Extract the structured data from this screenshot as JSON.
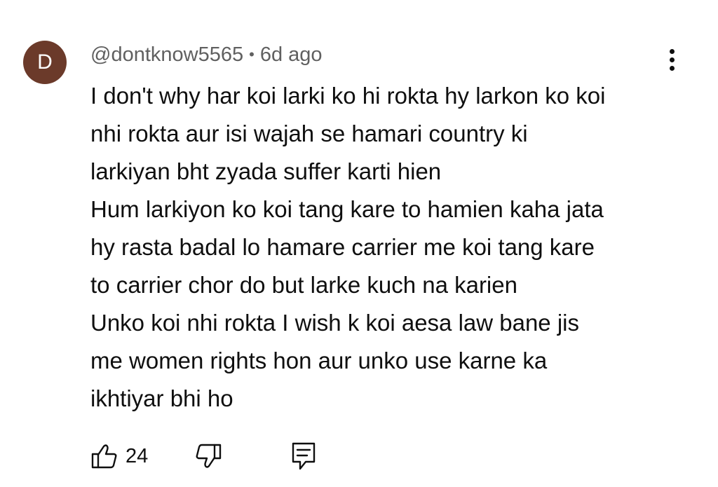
{
  "comment": {
    "avatar_letter": "D",
    "avatar_color": "#6b3a2a",
    "author": "@dontknow5565",
    "separator": "•",
    "time": "6d ago",
    "text_lines": [
      "I don't why har koi larki ko hi rokta hy larkon ko koi",
      "nhi rokta aur isi wajah se hamari country ki",
      "larkiyan bht zyada suffer karti hien",
      "Hum larkiyon ko koi tang kare to hamien kaha jata",
      "hy rasta badal lo hamare carrier me koi tang kare",
      "to carrier chor do but larke kuch na karien",
      "Unko koi nhi rokta I wish k koi aesa law bane jis",
      "me women rights hon aur unko use karne ka",
      "ikhtiyar bhi ho"
    ],
    "like_count": "24",
    "icons": {
      "more": "more-vertical-icon",
      "like": "thumbs-up-icon",
      "dislike": "thumbs-down-icon",
      "reply": "reply-comment-icon"
    }
  }
}
